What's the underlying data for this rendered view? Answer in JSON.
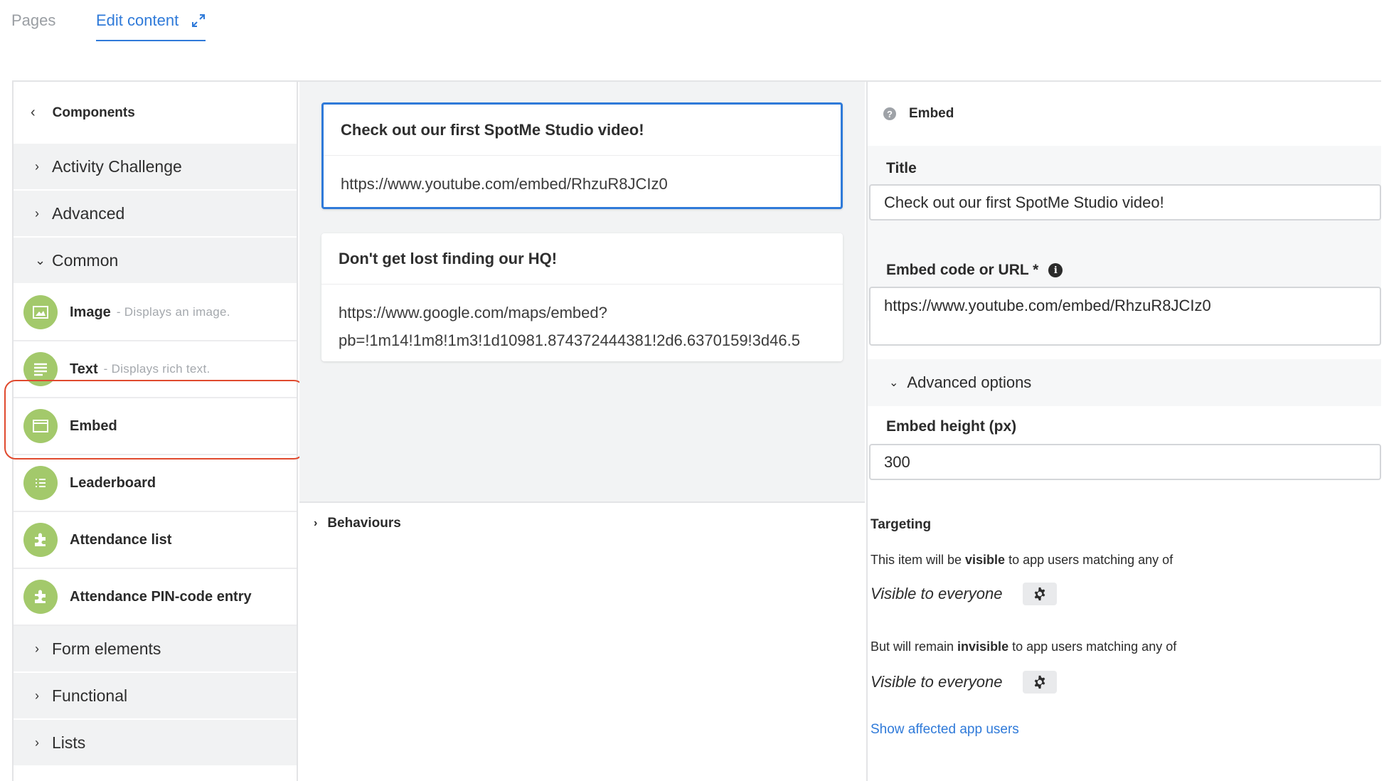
{
  "tabs": {
    "pages": "Pages",
    "edit_content": "Edit content"
  },
  "components_panel": {
    "title": "Components",
    "categories_top": [
      "Activity Challenge",
      "Advanced",
      "Common"
    ],
    "components": [
      {
        "name": "Image",
        "desc": "- Displays an image.",
        "icon": "image-icon"
      },
      {
        "name": "Text",
        "desc": "- Displays rich text.",
        "icon": "text-lines-icon"
      },
      {
        "name": "Embed",
        "desc": "",
        "icon": "embed-window-icon"
      },
      {
        "name": "Leaderboard",
        "desc": "",
        "icon": "list-icon"
      },
      {
        "name": "Attendance list",
        "desc": "",
        "icon": "puzzle-icon"
      },
      {
        "name": "Attendance PIN-code entry",
        "desc": "",
        "icon": "puzzle-icon"
      }
    ],
    "categories_bottom": [
      "Form elements",
      "Functional",
      "Lists"
    ]
  },
  "canvas": {
    "cards": [
      {
        "title": "Check out our first SpotMe Studio video!",
        "body_lines": [
          "https://www.youtube.com/embed/RhzuR8JCIz0"
        ]
      },
      {
        "title": "Don't get lost finding our HQ!",
        "body_lines": [
          "https://www.google.com/maps/embed?",
          "pb=!1m14!1m8!1m3!1d10981.874372444381!2d6.6370159!3d46.5"
        ]
      }
    ],
    "behaviours_label": "Behaviours"
  },
  "properties": {
    "header": "Embed",
    "title_label": "Title",
    "title_value": "Check out our first SpotMe Studio video!",
    "embed_label": "Embed code or URL *",
    "embed_value": "https://www.youtube.com/embed/RhzuR8JCIz0",
    "advanced_label": "Advanced options",
    "height_label": "Embed height (px)",
    "height_value": "300",
    "targeting": {
      "title": "Targeting",
      "visible_prefix": "This item will be ",
      "visible_bold": "visible",
      "visible_suffix": " to app users matching any of",
      "visible_value": "Visible to everyone",
      "invisible_prefix": "But will remain ",
      "invisible_bold": "invisible",
      "invisible_suffix": " to app users matching any of",
      "invisible_value": "Visible to everyone",
      "link": "Show affected app users"
    }
  },
  "colors": {
    "accent": "#2f7ad9",
    "component_icon": "#a3c96b",
    "highlight": "#e04a2e"
  }
}
